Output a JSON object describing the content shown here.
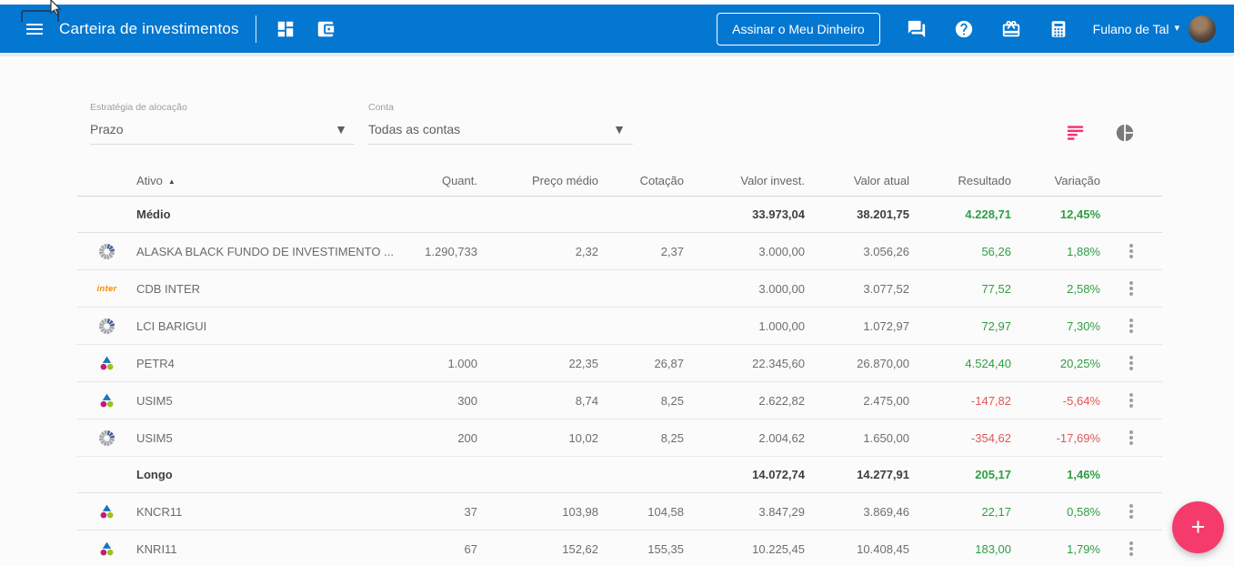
{
  "app": {
    "title": "Carteira de investimentos",
    "subscribe_button_label": "Assinar o Meu Dinheiro",
    "user_name": "Fulano de Tal"
  },
  "brand": {
    "inter_logo_text": "inter"
  },
  "filters": {
    "strategy_label": "Estratégia de alocação",
    "strategy_value": "Prazo",
    "account_label": "Conta",
    "account_value": "Todas as contas"
  },
  "glyphs": {
    "plus": "+",
    "sort_asc": "▲",
    "caret_down": "▾",
    "select_arrow": "▼"
  },
  "colors": {
    "header_blue": "#0477d1",
    "accent_pink": "#f43b6c",
    "positive_green": "#2f9e44",
    "negative_red": "#e15656"
  },
  "table": {
    "columns": [
      "Ativo",
      "Quant.",
      "Preço médio",
      "Cotação",
      "Valor invest.",
      "Valor atual",
      "Resultado",
      "Variação"
    ],
    "groups": [
      {
        "name": "Médio",
        "totals": {
          "valor_invest": "33.973,04",
          "valor_atual": "38.201,75",
          "resultado": "4.228,71",
          "variacao": "12,45%"
        },
        "rows": [
          {
            "icon": "fund",
            "ativo": "ALASKA BLACK FUNDO DE INVESTIMENTO ...",
            "quant": "1.290,733",
            "preco_medio": "2,32",
            "cotacao": "2,37",
            "valor_invest": "3.000,00",
            "valor_atual": "3.056,26",
            "resultado": "56,26",
            "variacao": "1,88%"
          },
          {
            "icon": "inter",
            "ativo": "CDB INTER",
            "quant": "",
            "preco_medio": "",
            "cotacao": "",
            "valor_invest": "3.000,00",
            "valor_atual": "3.077,52",
            "resultado": "77,52",
            "variacao": "2,58%"
          },
          {
            "icon": "fund",
            "ativo": "LCI BARIGUI",
            "quant": "",
            "preco_medio": "",
            "cotacao": "",
            "valor_invest": "1.000,00",
            "valor_atual": "1.072,97",
            "resultado": "72,97",
            "variacao": "7,30%"
          },
          {
            "icon": "b3",
            "ativo": "PETR4",
            "quant": "1.000",
            "preco_medio": "22,35",
            "cotacao": "26,87",
            "valor_invest": "22.345,60",
            "valor_atual": "26.870,00",
            "resultado": "4.524,40",
            "variacao": "20,25%"
          },
          {
            "icon": "b3",
            "ativo": "USIM5",
            "quant": "300",
            "preco_medio": "8,74",
            "cotacao": "8,25",
            "valor_invest": "2.622,82",
            "valor_atual": "2.475,00",
            "resultado": "-147,82",
            "variacao": "-5,64%"
          },
          {
            "icon": "fund",
            "ativo": "USIM5",
            "quant": "200",
            "preco_medio": "10,02",
            "cotacao": "8,25",
            "valor_invest": "2.004,62",
            "valor_atual": "1.650,00",
            "resultado": "-354,62",
            "variacao": "-17,69%"
          }
        ]
      },
      {
        "name": "Longo",
        "totals": {
          "valor_invest": "14.072,74",
          "valor_atual": "14.277,91",
          "resultado": "205,17",
          "variacao": "1,46%"
        },
        "rows": [
          {
            "icon": "b3",
            "ativo": "KNCR11",
            "quant": "37",
            "preco_medio": "103,98",
            "cotacao": "104,58",
            "valor_invest": "3.847,29",
            "valor_atual": "3.869,46",
            "resultado": "22,17",
            "variacao": "0,58%"
          },
          {
            "icon": "b3",
            "ativo": "KNRI11",
            "quant": "67",
            "preco_medio": "152,62",
            "cotacao": "155,35",
            "valor_invest": "10.225,45",
            "valor_atual": "10.408,45",
            "resultado": "183,00",
            "variacao": "1,79%"
          }
        ]
      }
    ]
  }
}
